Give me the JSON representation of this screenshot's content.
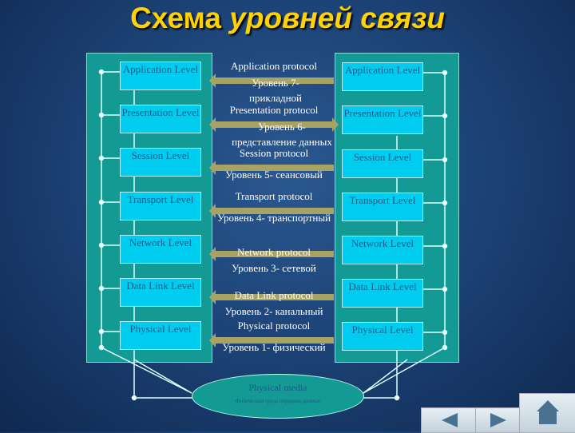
{
  "title": {
    "part1": "Схема ",
    "part2": "уровней связи"
  },
  "left_stack": [
    "Application Level",
    "Presentation Level",
    "Session Level",
    "Transport Level",
    "Network  Level",
    "Data Link Level",
    "Physical Level"
  ],
  "right_stack": [
    "Application Level",
    "Presentation Level",
    "Session Level",
    "Transport Level",
    "Network  Level",
    "Data Link Level",
    "Physical Level"
  ],
  "protocols": [
    {
      "name": "Application protocol",
      "ru": "Уровень 7- прикладной"
    },
    {
      "name": "Presentation protocol",
      "ru": "Уровень 6- представление данных"
    },
    {
      "name": "Session protocol",
      "ru": "Уровень 5- сеансовый"
    },
    {
      "name": "Transport protocol",
      "ru": "Уровень 4- транспортный"
    },
    {
      "name": "Network protocol",
      "ru": "Уровень 3- сетевой"
    },
    {
      "name": "Data Link protocol",
      "ru": "Уровень 2- канальный"
    },
    {
      "name": "Physical protocol",
      "ru": "Уровень 1- физический"
    }
  ],
  "media": {
    "label": "Physical media",
    "sub": "Физическая среда передачи данных"
  },
  "nav": {
    "prev": "previous-slide",
    "next": "next-slide",
    "home": "home"
  },
  "colors": {
    "title": "#ffd200",
    "panel": "#139a94",
    "box": "#00ccf0",
    "arrow": "#a8a264"
  }
}
